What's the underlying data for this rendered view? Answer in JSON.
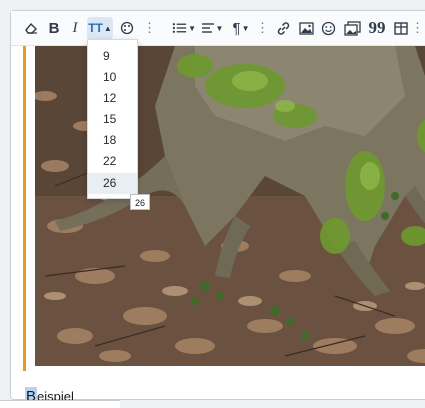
{
  "toolbar": {
    "buttons": [
      {
        "name": "clear-format-icon"
      },
      {
        "name": "bold-icon",
        "label": "B"
      },
      {
        "name": "italic-icon",
        "label": "I"
      },
      {
        "name": "font-size-icon",
        "label": "TT"
      },
      {
        "name": "palette-icon"
      },
      {
        "name": "more-vertical-icon",
        "label": "⋮"
      },
      {
        "name": "list-icon"
      },
      {
        "name": "align-icon"
      },
      {
        "name": "paragraph-icon",
        "label": "¶"
      },
      {
        "name": "more-vertical-icon",
        "label": "⋮"
      },
      {
        "name": "link-icon"
      },
      {
        "name": "image-icon"
      },
      {
        "name": "emoji-icon"
      },
      {
        "name": "media-icon"
      },
      {
        "name": "quote-icon",
        "label": "99"
      },
      {
        "name": "table-icon"
      },
      {
        "name": "more-vertical-icon",
        "label": "⋮"
      }
    ]
  },
  "font_size_menu": {
    "options": [
      "9",
      "10",
      "12",
      "15",
      "18",
      "22",
      "26"
    ],
    "selected": "26",
    "tooltip": "26"
  },
  "content": {
    "caption_first": "B",
    "caption_rest": "eispiel"
  },
  "colors": {
    "accent_bar": "#e69b1e",
    "selection": "#b7d4ef"
  }
}
